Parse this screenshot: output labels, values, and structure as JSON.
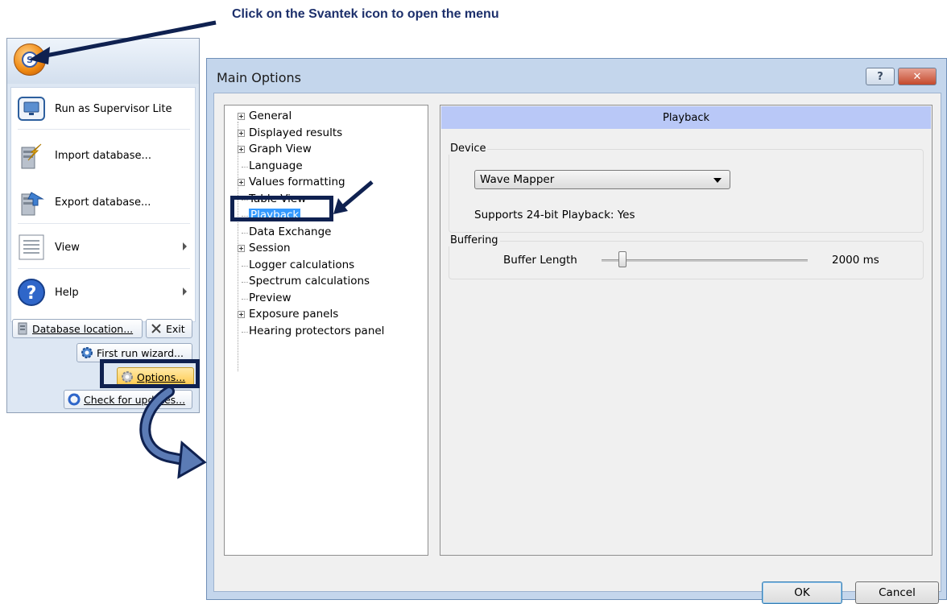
{
  "instruction": "Click on the Svantek icon to open the menu",
  "menu": {
    "items": [
      {
        "label": "Run as Supervisor Lite",
        "icon": "monitor-icon"
      },
      {
        "label": "Import database...",
        "icon": "import-database-icon"
      },
      {
        "label": "Export database...",
        "icon": "export-database-icon"
      },
      {
        "label": "View",
        "icon": "view-icon"
      },
      {
        "label": "Help",
        "icon": "help-icon"
      }
    ],
    "buttons": {
      "database_location": "Database location...",
      "exit": "Exit",
      "first_run_wizard": "First run wizard...",
      "options": "Options...",
      "check_updates": "Check for updates..."
    }
  },
  "dialog": {
    "title": "Main Options",
    "help_btn": "?",
    "close_btn": "✕",
    "tree": [
      {
        "label": "General",
        "expandable": true
      },
      {
        "label": "Displayed results",
        "expandable": true
      },
      {
        "label": "Graph View",
        "expandable": true
      },
      {
        "label": "Language",
        "expandable": false
      },
      {
        "label": "Values formatting",
        "expandable": true
      },
      {
        "label": "Table View",
        "expandable": false
      },
      {
        "label": "Playback",
        "expandable": false,
        "selected": true
      },
      {
        "label": "Data Exchange",
        "expandable": false
      },
      {
        "label": "Session",
        "expandable": true
      },
      {
        "label": "Logger calculations",
        "expandable": false
      },
      {
        "label": "Spectrum calculations",
        "expandable": false
      },
      {
        "label": "Preview",
        "expandable": false
      },
      {
        "label": "Exposure panels",
        "expandable": true
      },
      {
        "label": "Hearing protectors panel",
        "expandable": false
      }
    ],
    "panel": {
      "header": "Playback",
      "device_group": "Device",
      "device_value": "Wave Mapper",
      "supports_text": "Supports 24-bit Playback: Yes",
      "buffering_group": "Buffering",
      "buffer_label": "Buffer Length",
      "buffer_value": "2000 ms",
      "buffer_slider_fraction": 0.1
    },
    "ok": "OK",
    "cancel": "Cancel"
  },
  "colors": {
    "annotation": "#0f2150",
    "header_bar": "#b9c8f7",
    "selection": "#3399ff"
  }
}
